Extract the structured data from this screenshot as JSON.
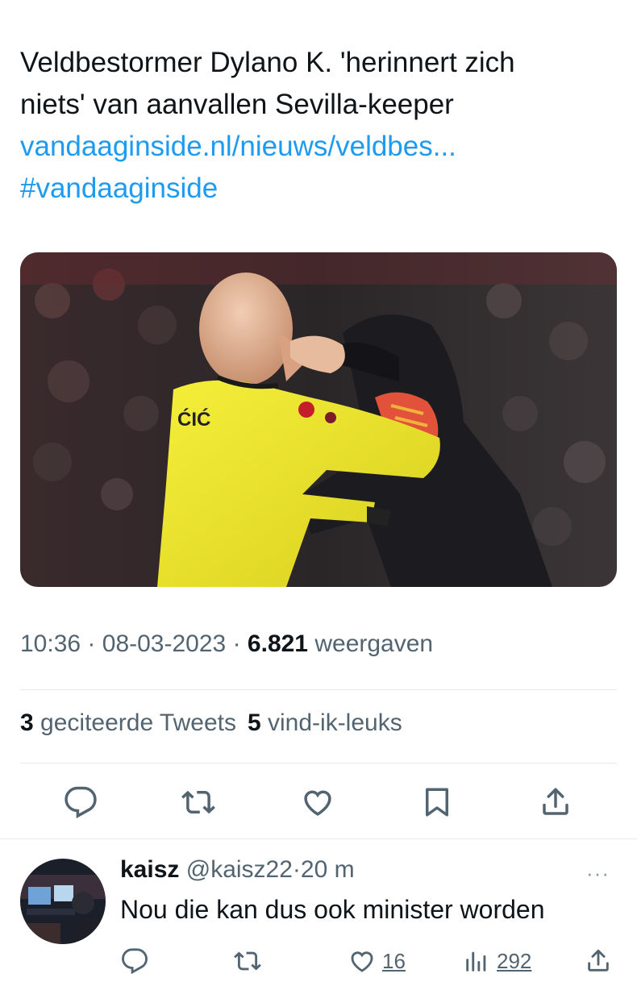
{
  "tweet": {
    "text_line1": "Veldbestormer Dylano K. 'herinnert zich",
    "text_line2": "niets' van aanvallen Sevilla-keeper",
    "link": "vandaaginside.nl/nieuws/veldbes...",
    "hashtag": "#vandaaginside",
    "media_alt": "Foto van een veldbestormer die de keeper van Sevilla aanvalt",
    "time": "10:36",
    "date": "08-03-2023",
    "views_count": "6.821",
    "views_label": "weergaven",
    "sep": "·"
  },
  "stats": {
    "quotes_count": "3",
    "quotes_label": "geciteerde Tweets",
    "likes_count": "5",
    "likes_label": "vind-ik-leuks"
  },
  "actions": {
    "icons": [
      "reply-icon",
      "retweet-icon",
      "like-icon",
      "bookmark-icon",
      "share-icon"
    ]
  },
  "reply": {
    "name": "kaisz",
    "handle": "@kaisz22",
    "sep": "·",
    "age": "20 m",
    "more": "···",
    "text": "Nou die kan dus ook minister worden",
    "likes": "16",
    "views": "292"
  },
  "colors": {
    "link": "#1d9bf0",
    "text": "#0f1419",
    "muted": "#536471",
    "divider": "#e7e9ea"
  }
}
